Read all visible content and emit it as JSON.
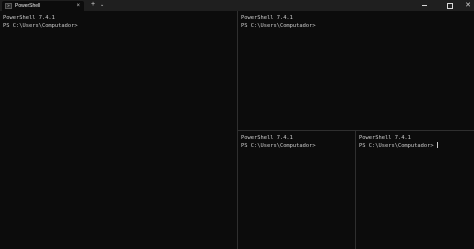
{
  "tab": {
    "title": "PowerShell",
    "icon": "powershell-icon",
    "close_label": "×"
  },
  "toolbar": {
    "new_tab_label": "+",
    "dropdown_label": "⌄"
  },
  "window_controls": {
    "minimize": "minimize-icon",
    "maximize": "maximize-icon",
    "close_label": "✕"
  },
  "panes": {
    "left": {
      "version": "PowerShell 7.4.1",
      "prompt": "PS C:\\Users\\Computador>"
    },
    "top_right": {
      "version": "PowerShell 7.4.1",
      "prompt": "PS C:\\Users\\Computador>"
    },
    "bottom_left": {
      "version": "PowerShell 7.4.1",
      "prompt": "PS C:\\Users\\Computador>"
    },
    "bottom_right": {
      "version": "PowerShell 7.4.1",
      "prompt": "PS C:\\Users\\Computador>"
    }
  },
  "colors": {
    "terminal_bg": "#0c0c0c",
    "titlebar_bg": "#1f1f1f",
    "text": "#cccccc",
    "divider": "#2f2f2f"
  }
}
